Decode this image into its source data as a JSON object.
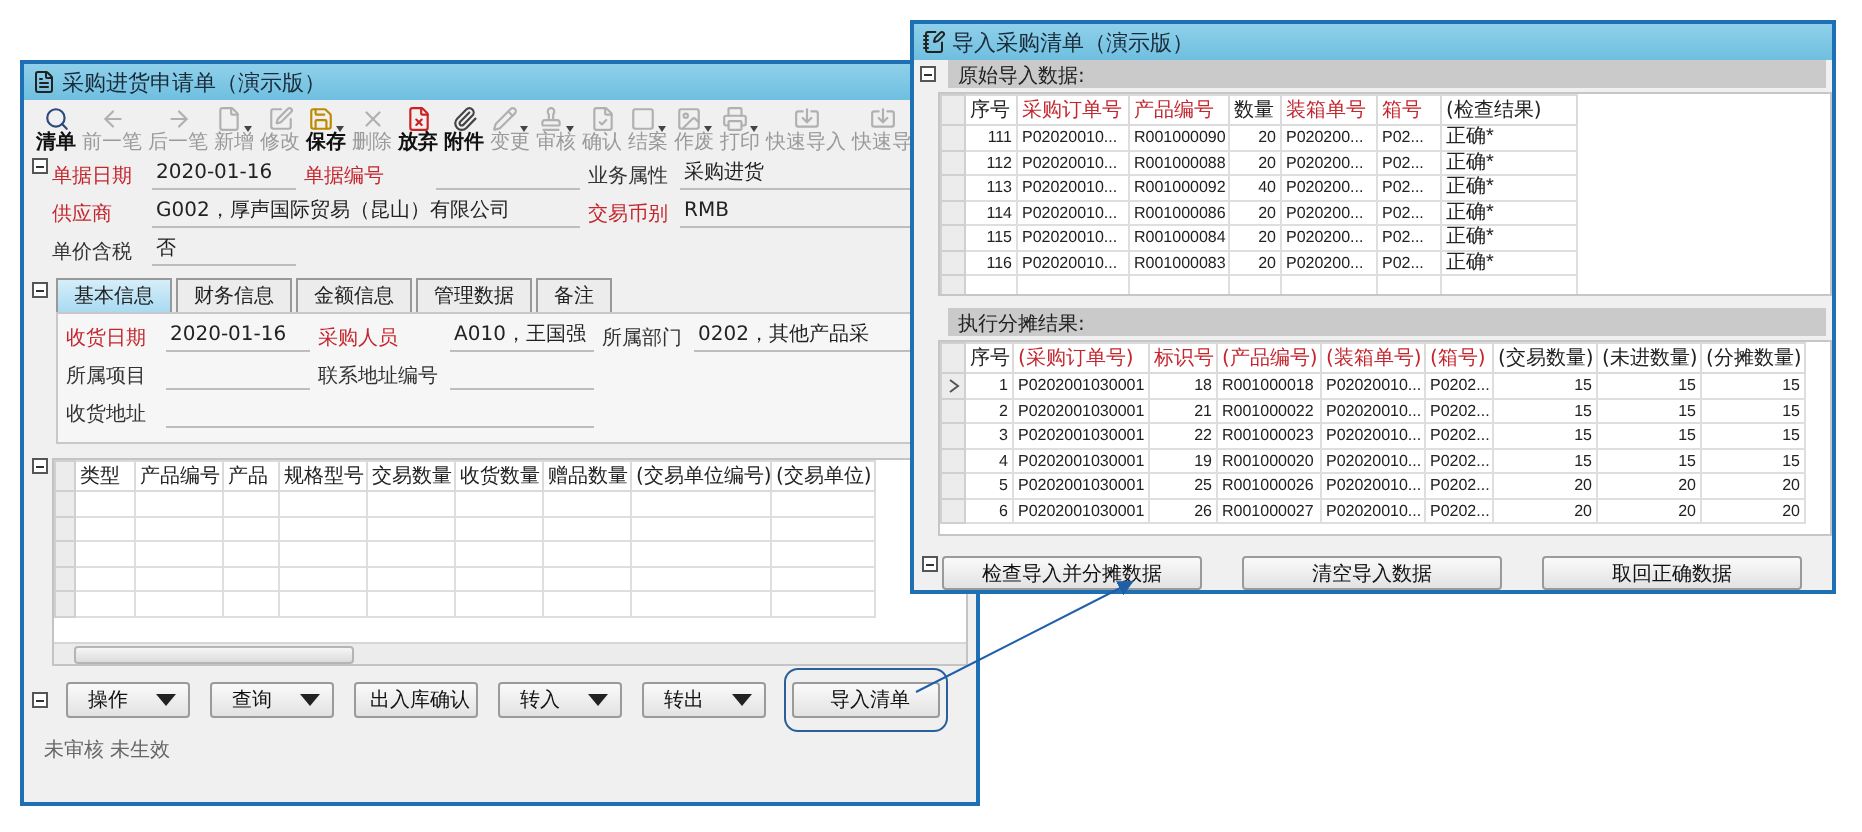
{
  "main_window": {
    "title": "采购进货申请单（演示版）",
    "toolbar": [
      {
        "label": "清单",
        "disabled": false,
        "menu": false
      },
      {
        "label": "前一笔",
        "disabled": true,
        "menu": false
      },
      {
        "label": "后一笔",
        "disabled": true,
        "menu": false
      },
      {
        "label": "新增",
        "disabled": true,
        "menu": true
      },
      {
        "label": "修改",
        "disabled": true,
        "menu": false
      },
      {
        "label": "保存",
        "disabled": false,
        "menu": true
      },
      {
        "label": "删除",
        "disabled": true,
        "menu": false
      },
      {
        "label": "放弃",
        "disabled": false,
        "menu": false
      },
      {
        "label": "附件",
        "disabled": false,
        "menu": false
      },
      {
        "label": "变更",
        "disabled": true,
        "menu": true
      },
      {
        "label": "审核",
        "disabled": true,
        "menu": true
      },
      {
        "label": "确认",
        "disabled": true,
        "menu": false
      },
      {
        "label": "结案",
        "disabled": true,
        "menu": true
      },
      {
        "label": "作废",
        "disabled": true,
        "menu": true
      },
      {
        "label": "打印",
        "disabled": true,
        "menu": true
      },
      {
        "label": "快速导入",
        "disabled": true,
        "menu": false
      },
      {
        "label": "快速导",
        "disabled": true,
        "menu": false
      }
    ],
    "header_rows": [
      [
        {
          "label": "单据日期",
          "required": true,
          "value": "2020-01-16"
        },
        {
          "label": "单据编号",
          "required": true
        },
        {
          "label": "业务属性",
          "required": false,
          "value": "采购进货"
        }
      ],
      [
        {
          "label": "供应商",
          "required": true,
          "value": "G002，厚声国际贸易（昆山）有限公司",
          "wide": true
        },
        {
          "label": "交易币别",
          "required": true,
          "value": "RMB"
        }
      ],
      [
        {
          "label": "单价含税",
          "required": false,
          "value": "否"
        }
      ]
    ],
    "tabs": [
      {
        "label": "基本信息",
        "selected": true
      },
      {
        "label": "财务信息",
        "selected": false
      },
      {
        "label": "金额信息",
        "selected": false
      },
      {
        "label": "管理数据",
        "selected": false
      },
      {
        "label": "备注",
        "selected": false
      }
    ],
    "tab_rows": [
      [
        {
          "label": "收货日期",
          "required": true,
          "value": "2020-01-16"
        },
        {
          "label": "采购人员",
          "required": true,
          "value": "A010，王国强"
        },
        {
          "label": "所属部门",
          "required": false,
          "value": "0202，其他产品采"
        }
      ],
      [
        {
          "label": "所属项目",
          "required": false
        },
        {
          "label": "联系地址编号",
          "required": false
        }
      ],
      [
        {
          "label": "收货地址",
          "required": false,
          "wide": true
        }
      ]
    ],
    "grid_columns": [
      "类型",
      "产品编号",
      "产品",
      "规格型号",
      "交易数量",
      "收货数量",
      "赠品数量",
      "(交易单位编号)",
      "(交易单位)"
    ],
    "buttons": [
      {
        "label": "操作",
        "menu": true,
        "highlighted": false
      },
      {
        "label": "查询",
        "menu": true,
        "highlighted": false
      },
      {
        "label": "出入库确认",
        "menu": false,
        "highlighted": false
      },
      {
        "label": "转入",
        "menu": true,
        "highlighted": false
      },
      {
        "label": "转出",
        "menu": true,
        "highlighted": false
      },
      {
        "label": "导入清单",
        "menu": false,
        "highlighted": true
      }
    ],
    "status": "未审核 未生效"
  },
  "import_window": {
    "title": "导入采购清单（演示版）",
    "source": {
      "title": "原始导入数据:",
      "columns": [
        {
          "label": "序号",
          "required": false
        },
        {
          "label": "采购订单号",
          "required": true
        },
        {
          "label": "产品编号",
          "required": true
        },
        {
          "label": "数量",
          "required": false
        },
        {
          "label": "装箱单号",
          "required": true
        },
        {
          "label": "箱号",
          "required": true
        },
        {
          "label": "(检查结果)",
          "required": false
        }
      ],
      "rows": [
        [
          "111",
          "P02020010...",
          "R001000090",
          "20",
          "P020200...",
          "P02...",
          "正确*"
        ],
        [
          "112",
          "P02020010...",
          "R001000088",
          "20",
          "P020200...",
          "P02...",
          "正确*"
        ],
        [
          "113",
          "P02020010...",
          "R001000092",
          "40",
          "P020200...",
          "P02...",
          "正确*"
        ],
        [
          "114",
          "P02020010...",
          "R001000086",
          "20",
          "P020200...",
          "P02...",
          "正确*"
        ],
        [
          "115",
          "P02020010...",
          "R001000084",
          "20",
          "P020200...",
          "P02...",
          "正确*"
        ],
        [
          "116",
          "P02020010...",
          "R001000083",
          "20",
          "P020200...",
          "P02...",
          "正确*"
        ]
      ]
    },
    "result": {
      "title": "执行分摊结果:",
      "columns": [
        {
          "label": "序号",
          "required": false
        },
        {
          "label": "(采购订单号)",
          "required": true
        },
        {
          "label": "标识号",
          "required": true
        },
        {
          "label": "(产品编号)",
          "required": true
        },
        {
          "label": "(装箱单号)",
          "required": true
        },
        {
          "label": "(箱号)",
          "required": true
        },
        {
          "label": "(交易数量)",
          "required": false
        },
        {
          "label": "(未进数量)",
          "required": false
        },
        {
          "label": "(分摊数量)",
          "required": false
        }
      ],
      "rows": [
        {
          "current": true,
          "cells": [
            "1",
            "P0202001030001",
            "18",
            "R001000018",
            "P02020010...",
            "P0202...",
            "15",
            "15",
            "15"
          ]
        },
        {
          "current": false,
          "cells": [
            "2",
            "P0202001030001",
            "21",
            "R001000022",
            "P02020010...",
            "P0202...",
            "15",
            "15",
            "15"
          ]
        },
        {
          "current": false,
          "cells": [
            "3",
            "P0202001030001",
            "22",
            "R001000023",
            "P02020010...",
            "P0202...",
            "15",
            "15",
            "15"
          ]
        },
        {
          "current": false,
          "cells": [
            "4",
            "P0202001030001",
            "19",
            "R001000020",
            "P02020010...",
            "P0202...",
            "15",
            "15",
            "15"
          ]
        },
        {
          "current": false,
          "cells": [
            "5",
            "P0202001030001",
            "25",
            "R001000026",
            "P02020010...",
            "P0202...",
            "20",
            "20",
            "20"
          ]
        },
        {
          "current": false,
          "cells": [
            "6",
            "P0202001030001",
            "26",
            "R001000027",
            "P02020010...",
            "P0202...",
            "20",
            "20",
            "20"
          ]
        }
      ]
    },
    "buttons": [
      "检查导入并分摊数据",
      "清空导入数据",
      "取回正确数据"
    ]
  }
}
